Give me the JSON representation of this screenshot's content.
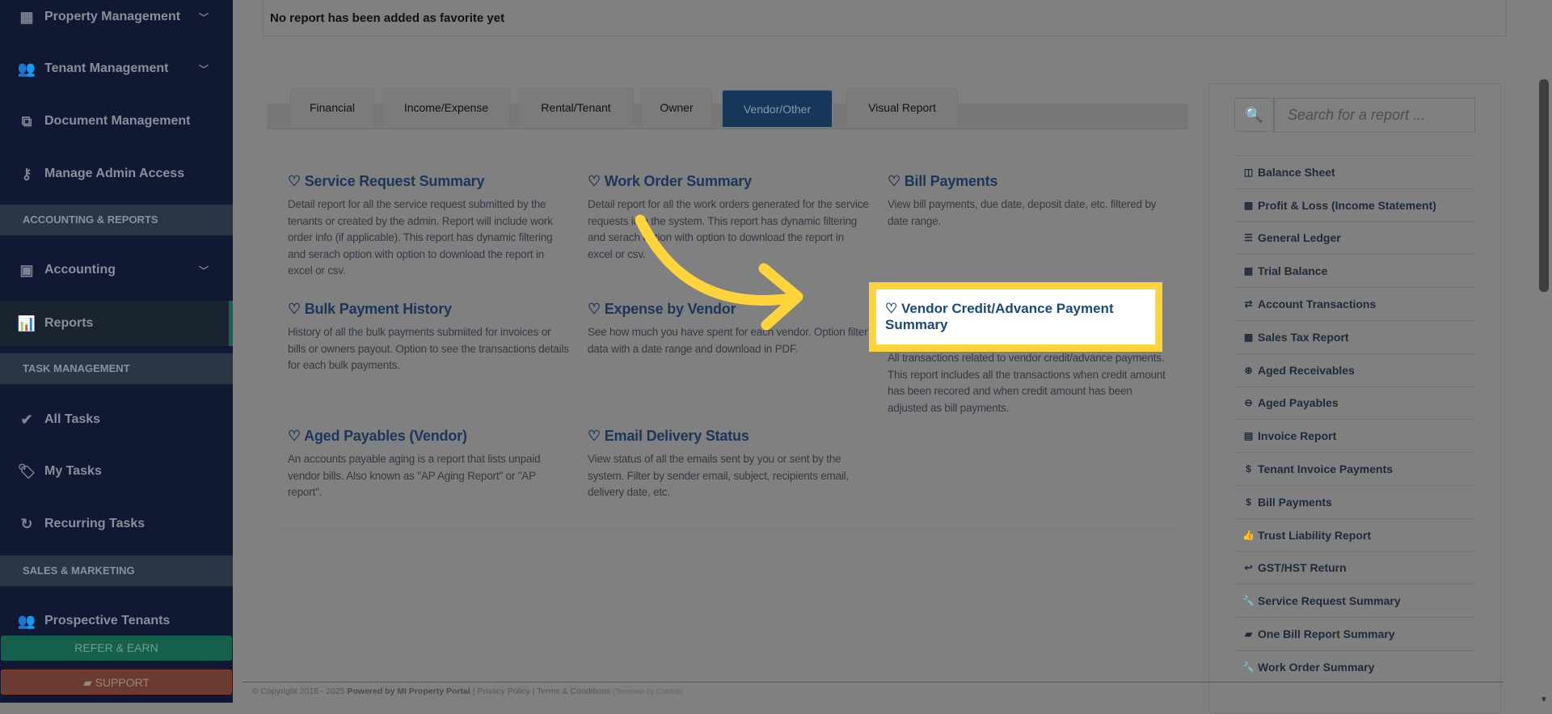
{
  "sidebar": {
    "items": [
      {
        "label": "Property Management",
        "icon": "building-icon"
      },
      {
        "label": "Tenant Management",
        "icon": "users-icon"
      },
      {
        "label": "Document Management",
        "icon": "documents-icon"
      },
      {
        "label": "Manage Admin Access",
        "icon": "key-icon"
      },
      {
        "label": "Accounting",
        "icon": "money-icon"
      },
      {
        "label": "Reports",
        "icon": "bar-chart-icon"
      },
      {
        "label": "All Tasks",
        "icon": "check-icon"
      },
      {
        "label": "My Tasks",
        "icon": "tag-icon"
      },
      {
        "label": "Recurring Tasks",
        "icon": "refresh-icon"
      },
      {
        "label": "Prospective Tenants",
        "icon": "users-icon"
      }
    ],
    "sections": [
      "ACCOUNTING & REPORTS",
      "TASK MANAGEMENT",
      "SALES & MARKETING"
    ],
    "refer": "REFER & EARN",
    "support": "SUPPORT",
    "refer_color": "#15604a",
    "support_color": "#6a3b30"
  },
  "favorites": {
    "empty_text": "No report has been added as favorite yet"
  },
  "tabs": [
    "Financial",
    "Income/Expense",
    "Rental/Tenant",
    "Owner",
    "Vendor/Other",
    "Visual Report"
  ],
  "active_tab": "Vendor/Other",
  "reports": [
    {
      "title": "Service Request Summary",
      "desc": "Detail report for all the service request submitted by the tenants or created by the admin. Report will include work order info (if applicable). This report has dynamic filtering and serach option with option to download the report in excel or csv."
    },
    {
      "title": "Work Order Summary",
      "desc": "Detail report for all the work orders generated for the service requests into the system. This report has dynamic filtering and serach option with option to download the report in excel or csv."
    },
    {
      "title": "Bill Payments",
      "desc": "View bill payments, due date, deposit date, etc. filtered by date range."
    },
    {
      "title": "Bulk Payment History",
      "desc": "History of all the bulk payments submiited for invoices or bills or owners payout. Option to see the transactions details for each bulk payments."
    },
    {
      "title": "Expense by Vendor",
      "desc": "See how much you have spent for each vendor. Option filter data with a date range and download in PDF."
    },
    {
      "title": "Vendor Credit/Advance Payment Summary",
      "desc": "All transactions related to vendor credit/advance payments. This report includes all the transactions when credit amount has been recored and when credit amount has been adjusted as bill payments."
    },
    {
      "title": "Aged Payables (Vendor)",
      "desc": "An accounts payable aging is a report that lists unpaid vendor bills. Also known as \"AP Aging Report\" or \"AP report\"."
    },
    {
      "title": "Email Delivery Status",
      "desc": "View status of all the emails sent by you or sent by the system. Filter by sender email, subject, recipients email, delivery date, etc."
    }
  ],
  "search": {
    "placeholder": "Search for a report ..."
  },
  "report_list": [
    {
      "label": "Balance Sheet",
      "icon": "columns-icon",
      "glyph": "◫"
    },
    {
      "label": "Profit & Loss (Income Statement)",
      "icon": "calculator-icon",
      "glyph": "▦"
    },
    {
      "label": "General Ledger",
      "icon": "list-icon",
      "glyph": "☰"
    },
    {
      "label": "Trial Balance",
      "icon": "calendar-icon",
      "glyph": "▦"
    },
    {
      "label": "Account Transactions",
      "icon": "exchange-icon",
      "glyph": "⇄"
    },
    {
      "label": "Sales Tax Report",
      "icon": "calculator-icon",
      "glyph": "▦"
    },
    {
      "label": "Aged Receivables",
      "icon": "arrow-circle-right-icon",
      "glyph": "⊛"
    },
    {
      "label": "Aged Payables",
      "icon": "arrow-circle-left-icon",
      "glyph": "⊖"
    },
    {
      "label": "Invoice Report",
      "icon": "file-code-icon",
      "glyph": "▤"
    },
    {
      "label": "Tenant Invoice Payments",
      "icon": "dollar-icon",
      "glyph": "$"
    },
    {
      "label": "Bill Payments",
      "icon": "dollar-icon",
      "glyph": "$"
    },
    {
      "label": "Trust Liability Report",
      "icon": "thumbs-up-icon",
      "glyph": "👍"
    },
    {
      "label": "GST/HST Return",
      "icon": "reply-icon",
      "glyph": "↩"
    },
    {
      "label": "Service Request Summary",
      "icon": "wrench-icon",
      "glyph": "🔧"
    },
    {
      "label": "One Bill Report Summary",
      "icon": "book-icon",
      "glyph": "▰"
    },
    {
      "label": "Work Order Summary",
      "icon": "wrench-icon",
      "glyph": "🔧"
    }
  ],
  "footer": {
    "copyright": "© Copyright 2016 - 2025",
    "powered": "Powered by MI Property Portal",
    "sep": "|",
    "privacy": "Privacy Policy",
    "terms": "Terms & Conditions",
    "template": "(Template by Colorlib)"
  },
  "highlight_color": "#ffd43b"
}
